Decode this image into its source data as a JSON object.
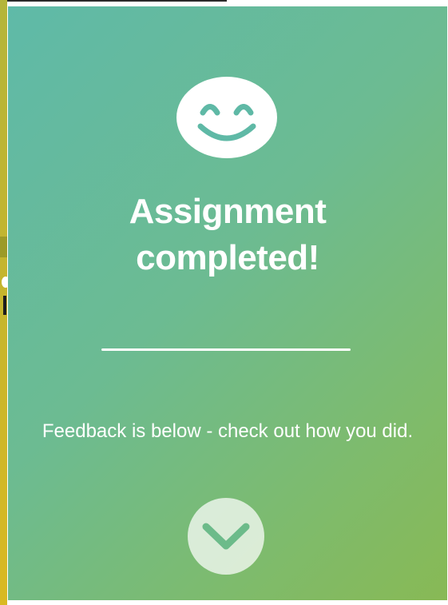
{
  "card": {
    "title_line1": "Assignment",
    "title_line2": "completed!",
    "feedback_text": "Feedback is below - check out how you did."
  },
  "icons": {
    "top": "smiley-face-icon",
    "bottom": "chevron-down-icon"
  },
  "colors": {
    "gradient_start": "#5fbaa8",
    "gradient_end": "#88b955",
    "smiley_fill": "#ffffff",
    "smiley_features": "#5fb9a6",
    "chevron": "#6cbb8a",
    "side_strip": "#c4b52e"
  }
}
